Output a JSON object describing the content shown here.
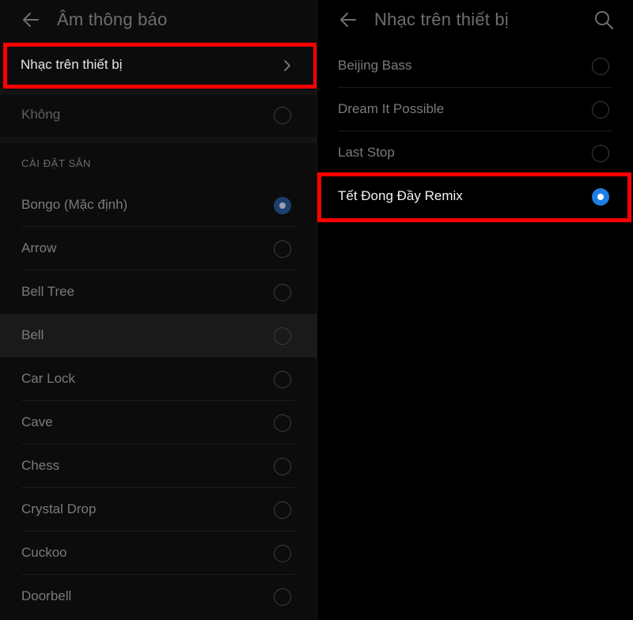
{
  "left_screen": {
    "title": "Âm thông báo",
    "device_music_label": "Nhạc trên thiết bị",
    "none_option": "Không",
    "section_header": "CÀI ĐẶT SẴN",
    "presets": [
      {
        "label": "Bongo (Mặc định)",
        "selected": true
      },
      {
        "label": "Arrow",
        "selected": false
      },
      {
        "label": "Bell Tree",
        "selected": false
      },
      {
        "label": "Bell",
        "selected": false
      },
      {
        "label": "Car Lock",
        "selected": false
      },
      {
        "label": "Cave",
        "selected": false
      },
      {
        "label": "Chess",
        "selected": false
      },
      {
        "label": "Crystal Drop",
        "selected": false
      },
      {
        "label": "Cuckoo",
        "selected": false
      },
      {
        "label": "Doorbell",
        "selected": false
      }
    ]
  },
  "right_screen": {
    "title": "Nhạc trên thiết bị",
    "songs": [
      {
        "label": "Beijing Bass",
        "selected": false
      },
      {
        "label": "Dream It Possible",
        "selected": false
      },
      {
        "label": "Last Stop",
        "selected": false
      },
      {
        "label": "Tết Đong Đầy Remix",
        "selected": true
      }
    ]
  },
  "colors": {
    "highlight": "#ff0000",
    "radio_selected": "#1e7fe3",
    "background": "#000000"
  },
  "icons": {
    "back": "back-arrow-icon",
    "search": "search-icon",
    "chevron": "chevron-right-icon"
  }
}
